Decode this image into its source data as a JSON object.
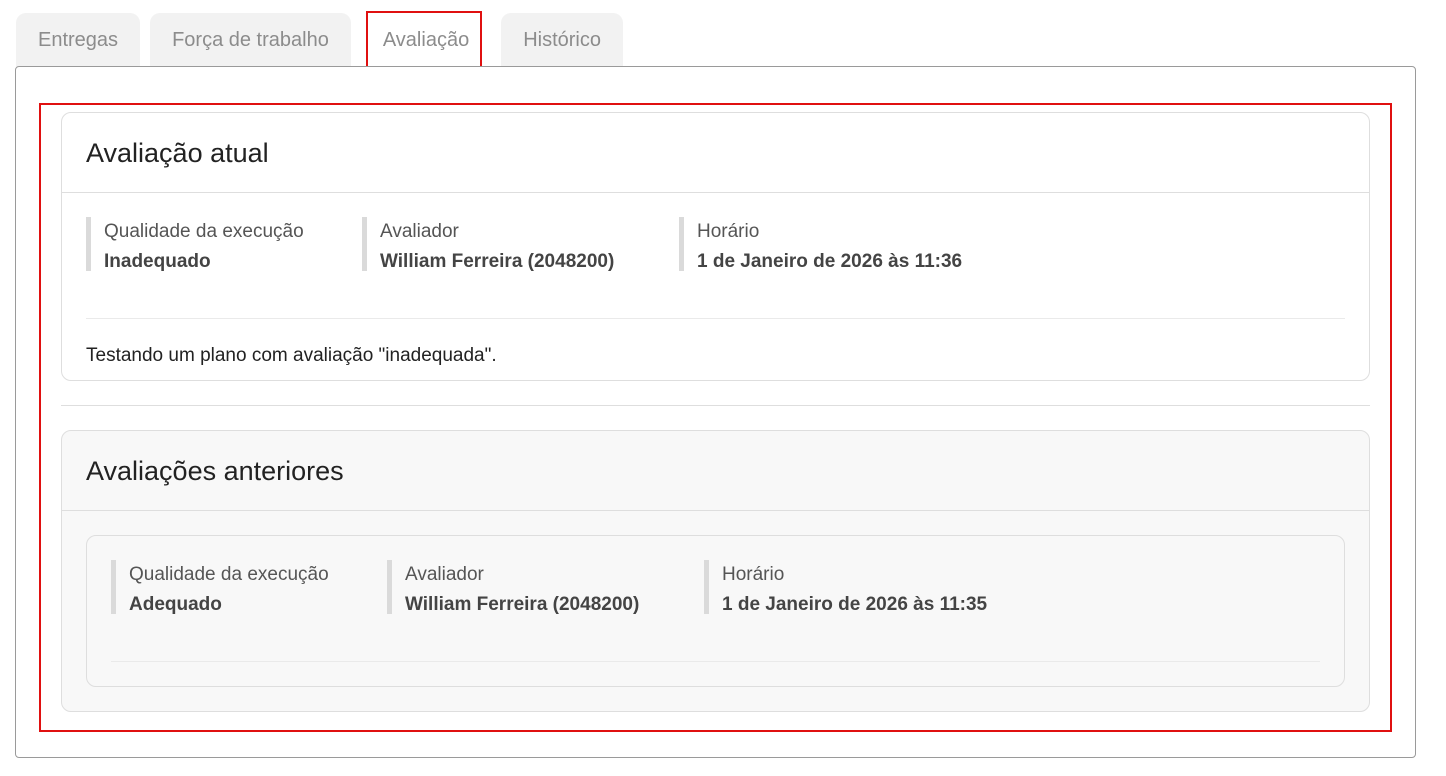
{
  "tabs": [
    {
      "label": "Entregas"
    },
    {
      "label": "Força de trabalho"
    },
    {
      "label": "Avaliação"
    },
    {
      "label": "Histórico"
    }
  ],
  "current": {
    "title": "Avaliação atual",
    "fields": [
      {
        "label": "Qualidade da execução",
        "value": "Inadequado"
      },
      {
        "label": "Avaliador",
        "value": "William Ferreira (2048200)"
      },
      {
        "label": "Horário",
        "value": "1 de Janeiro de 2026 às 11:36"
      }
    ],
    "comment": "Testando um plano com avaliação \"inadequada\"."
  },
  "previous": {
    "title": "Avaliações anteriores",
    "items": [
      {
        "fields": [
          {
            "label": "Qualidade da execução",
            "value": "Adequado"
          },
          {
            "label": "Avaliador",
            "value": "William Ferreira (2048200)"
          },
          {
            "label": "Horário",
            "value": "1 de Janeiro de 2026 às 11:35"
          }
        ]
      }
    ]
  },
  "colors": {
    "highlight": "#e01010",
    "tab_inactive_bg": "#f2f2f2",
    "card_muted_bg": "#f8f8f8"
  }
}
